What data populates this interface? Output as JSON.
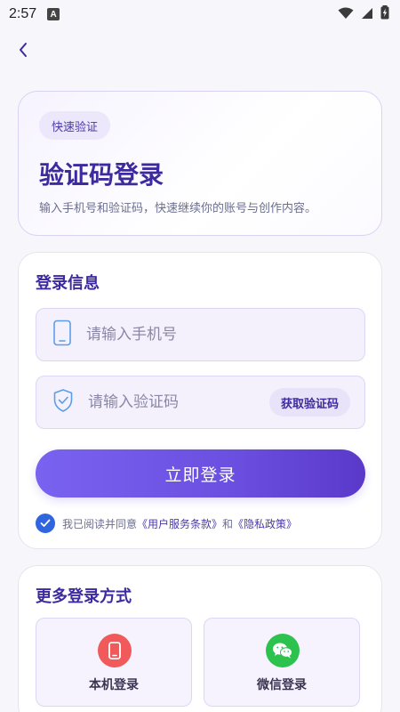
{
  "status_bar": {
    "time": "2:57",
    "notification_badge": "A",
    "icons": [
      "wifi-icon",
      "signal-icon",
      "battery-charging-icon"
    ]
  },
  "hero": {
    "badge": "快速验证",
    "title": "验证码登录",
    "subtitle": "输入手机号和验证码，快速继续你的账号与创作内容。"
  },
  "login": {
    "section_title": "登录信息",
    "phone_placeholder": "请输入手机号",
    "code_placeholder": "请输入验证码",
    "get_code_label": "获取验证码",
    "submit_label": "立即登录",
    "agreement": {
      "checked": true,
      "prefix": "我已阅读并同意",
      "terms": "《用户服务条款》",
      "and": "和",
      "privacy": "《隐私政策》"
    }
  },
  "more_login": {
    "title": "更多登录方式",
    "options": [
      {
        "label": "本机登录",
        "icon": "phone-icon",
        "color": "#f05a5a"
      },
      {
        "label": "微信登录",
        "icon": "wechat-icon",
        "color": "#2dc24d"
      }
    ]
  },
  "colors": {
    "accent": "#3c2a9e",
    "button_start": "#7a62f0",
    "button_end": "#5a39c9",
    "check": "#2f66e0"
  }
}
